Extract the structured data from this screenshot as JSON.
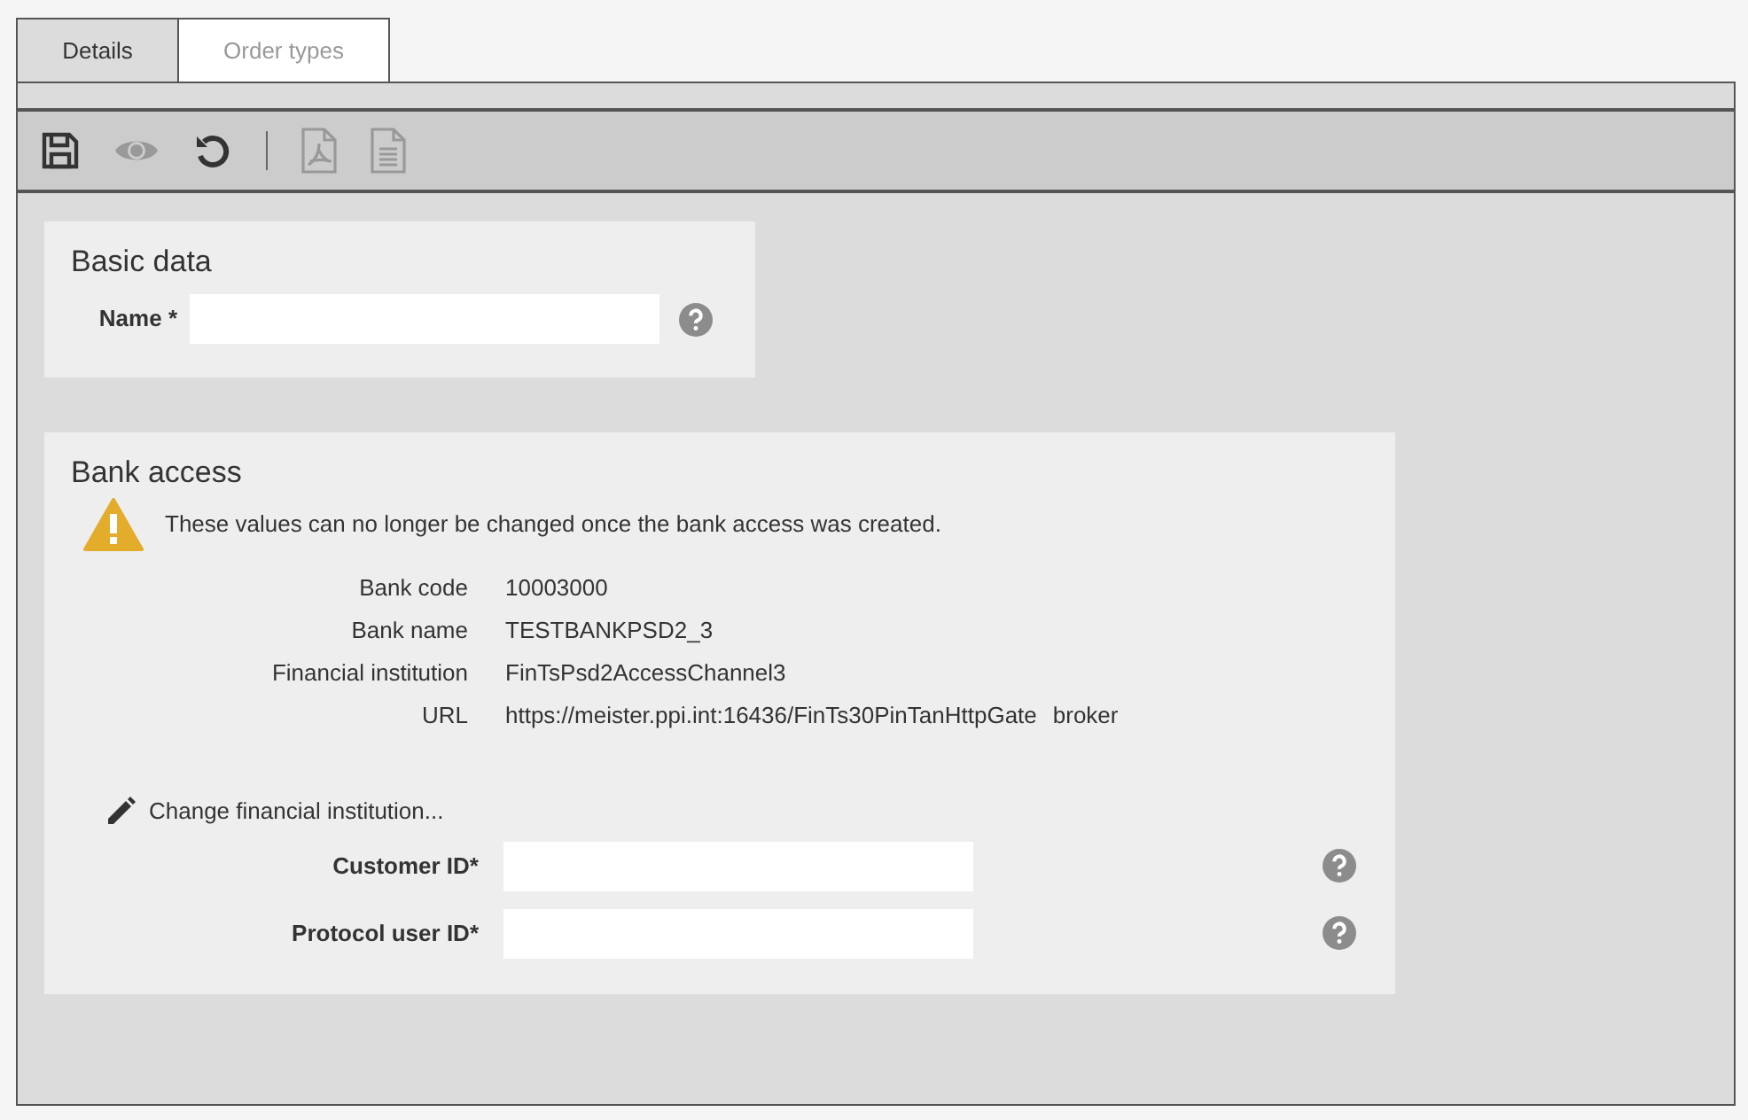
{
  "tabs": [
    {
      "label": "Details",
      "selected": true
    },
    {
      "label": "Order types",
      "selected": false
    }
  ],
  "toolbar": [
    {
      "kind": "save",
      "disabled": false
    },
    {
      "kind": "view",
      "disabled": true
    },
    {
      "kind": "undo",
      "disabled": false
    },
    {
      "kind": "separator"
    },
    {
      "kind": "pdf",
      "disabled": true
    },
    {
      "kind": "document",
      "disabled": true
    }
  ],
  "basic_data": {
    "title": "Basic data",
    "fields": [
      {
        "label": "Name *"
      }
    ]
  },
  "bank_access": {
    "title": "Bank access",
    "warning": "These values can no longer be changed once the bank access was created.",
    "details": [
      {
        "label": "Bank code",
        "value": "10003000"
      },
      {
        "label": "Bank name",
        "value": "TESTBANKPSD2_3"
      },
      {
        "label": "Financial institution",
        "value": "FinTsPsd2AccessChannel3"
      },
      {
        "label": "URL",
        "value": "https://meister.ppi.int:16436/FinTs30PinTanHttpGate",
        "extra": "broker"
      }
    ],
    "change_link": "Change financial institution...",
    "fields": [
      {
        "label": "Customer ID*"
      },
      {
        "label": "Protocol user ID*"
      }
    ]
  }
}
